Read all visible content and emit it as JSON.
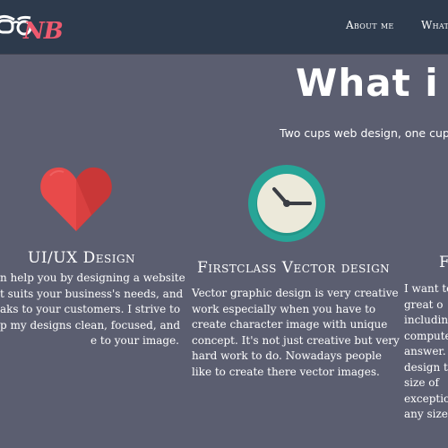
{
  "navbar": {
    "logo_text": "NB",
    "about_label": "About me",
    "what_label": "What"
  },
  "hero": {
    "title": "What i d",
    "subtitle": "Two cups web design, one cup ide"
  },
  "colors": {
    "background": "#5b5e70",
    "navbar": "#2d3a4c",
    "logo_accent": "#ee5a6f",
    "heart_red": "#e84a4a",
    "clock_teal": "#27a597",
    "clock_face": "#ece9da"
  },
  "columns": [
    {
      "icon": "heart-icon",
      "title": "UI/UX Design",
      "lines": [
        "n help you by designing a website",
        "t suits your business's needs, and",
        "aks to your customers. I strive to",
        "p my designs clean, focused, and",
        "e to your image."
      ]
    },
    {
      "icon": "clock-icon",
      "title": "Firstclass Vector design",
      "lines": [
        "Vector graphic design is very creative",
        "work especially when you have to",
        "create character image with unique",
        "concept. It's not just creative but very",
        "hard work to do. Nowadays people",
        "like to create there vector images."
      ]
    },
    {
      "icon": "",
      "title": "F",
      "lines": [
        "I want to",
        "great o",
        "including",
        "compute",
        "answer. I",
        "design th",
        "size of",
        "exceptio",
        "any size."
      ]
    }
  ]
}
